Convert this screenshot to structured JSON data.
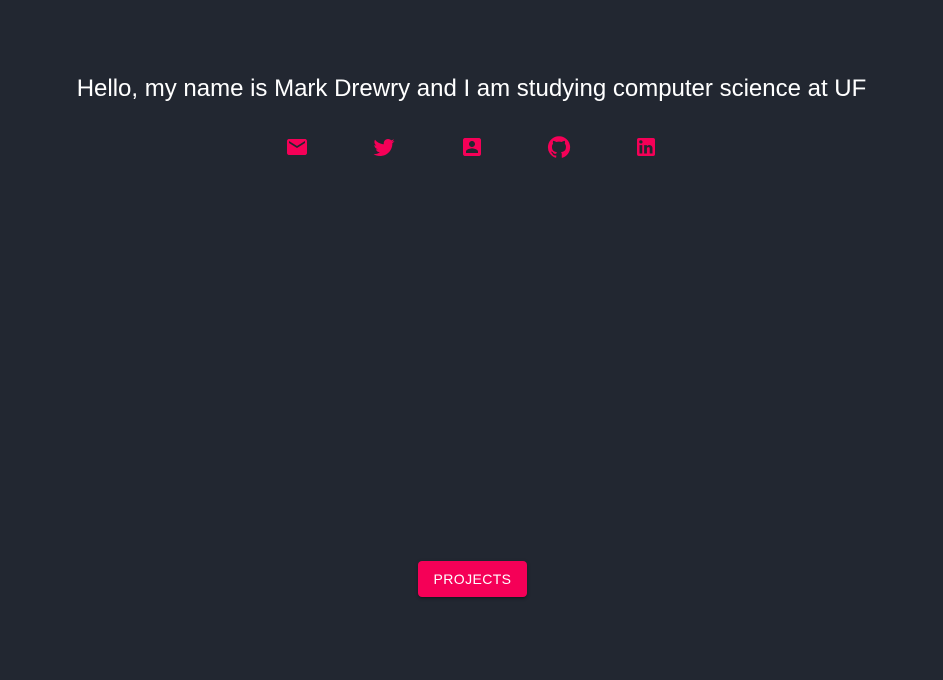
{
  "intro": {
    "text": "Hello, my name is Mark Drewry and I am studying computer science at UF"
  },
  "social": {
    "items": [
      {
        "name": "email",
        "icon": "email-icon"
      },
      {
        "name": "twitter",
        "icon": "twitter-icon"
      },
      {
        "name": "contact",
        "icon": "contact-card-icon"
      },
      {
        "name": "github",
        "icon": "github-icon"
      },
      {
        "name": "linkedin",
        "icon": "linkedin-icon"
      }
    ]
  },
  "actions": {
    "projects_label": "Projects"
  },
  "colors": {
    "background": "#222731",
    "accent": "#f50057",
    "text": "#ffffff"
  }
}
